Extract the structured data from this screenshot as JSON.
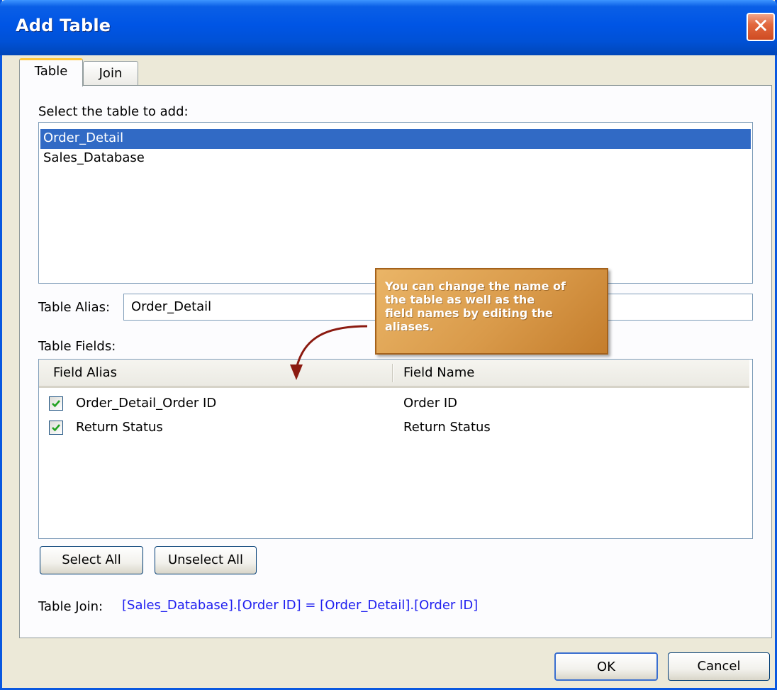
{
  "window": {
    "title": "Add Table",
    "close_glyph": "✕"
  },
  "tabs": [
    {
      "label": "Table",
      "active": true
    },
    {
      "label": "Join",
      "active": false
    }
  ],
  "table_select": {
    "label": "Select the table to add:",
    "items": [
      {
        "label": "Order_Detail",
        "selected": true
      },
      {
        "label": "Sales_Database",
        "selected": false
      }
    ]
  },
  "alias": {
    "label": "Table Alias:",
    "value": "Order_Detail"
  },
  "fields": {
    "label": "Table Fields:",
    "columns": [
      "Field Alias",
      "Field Name"
    ],
    "rows": [
      {
        "checked": true,
        "alias": "Order_Detail_Order ID",
        "name": "Order ID"
      },
      {
        "checked": true,
        "alias": "Return Status",
        "name": "Return Status"
      }
    ]
  },
  "buttons": {
    "select_all": "Select All",
    "unselect_all": "Unselect All",
    "ok": "OK",
    "cancel": "Cancel"
  },
  "join": {
    "label": "Table Join:",
    "expression": "[Sales_Database].[Order ID] = [Order_Detail].[Order ID]"
  },
  "callout": {
    "lines": [
      "You can change the name of",
      "the table as well as the",
      "field names by editing the",
      "aliases."
    ]
  },
  "colors": {
    "titlebar": "#0055e5",
    "selection": "#316ac5",
    "join_text": "#2020f0",
    "callout": "#d99a4a",
    "check": "#21a121"
  }
}
